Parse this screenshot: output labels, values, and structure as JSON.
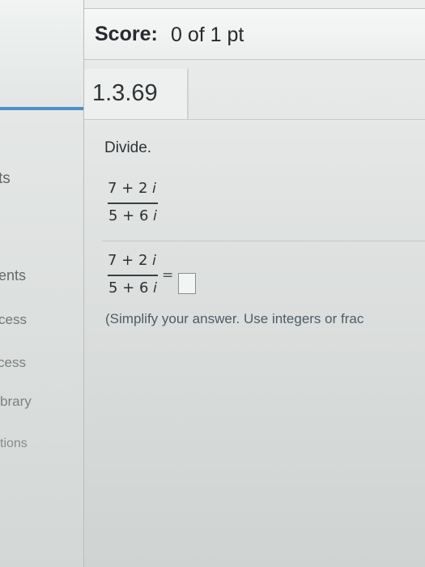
{
  "sidebar": {
    "items": [
      {
        "label": "ts"
      },
      {
        "label": "ents"
      },
      {
        "label": "cess"
      },
      {
        "label": "cess"
      },
      {
        "label": "brary"
      },
      {
        "label": "tions"
      }
    ]
  },
  "header": {
    "score_label": "Score:",
    "score_value": "0 of 1 pt"
  },
  "question": {
    "number": "1.3.69",
    "instruction": "Divide.",
    "numerator": "7 + 2 𝑖",
    "denominator": "5 + 6 𝑖",
    "answer_numerator": "7 + 2 𝑖",
    "answer_denominator": "5 + 6 𝑖",
    "equals": "=",
    "answer_value": "",
    "hint": "(Simplify your answer. Use integers or frac"
  }
}
